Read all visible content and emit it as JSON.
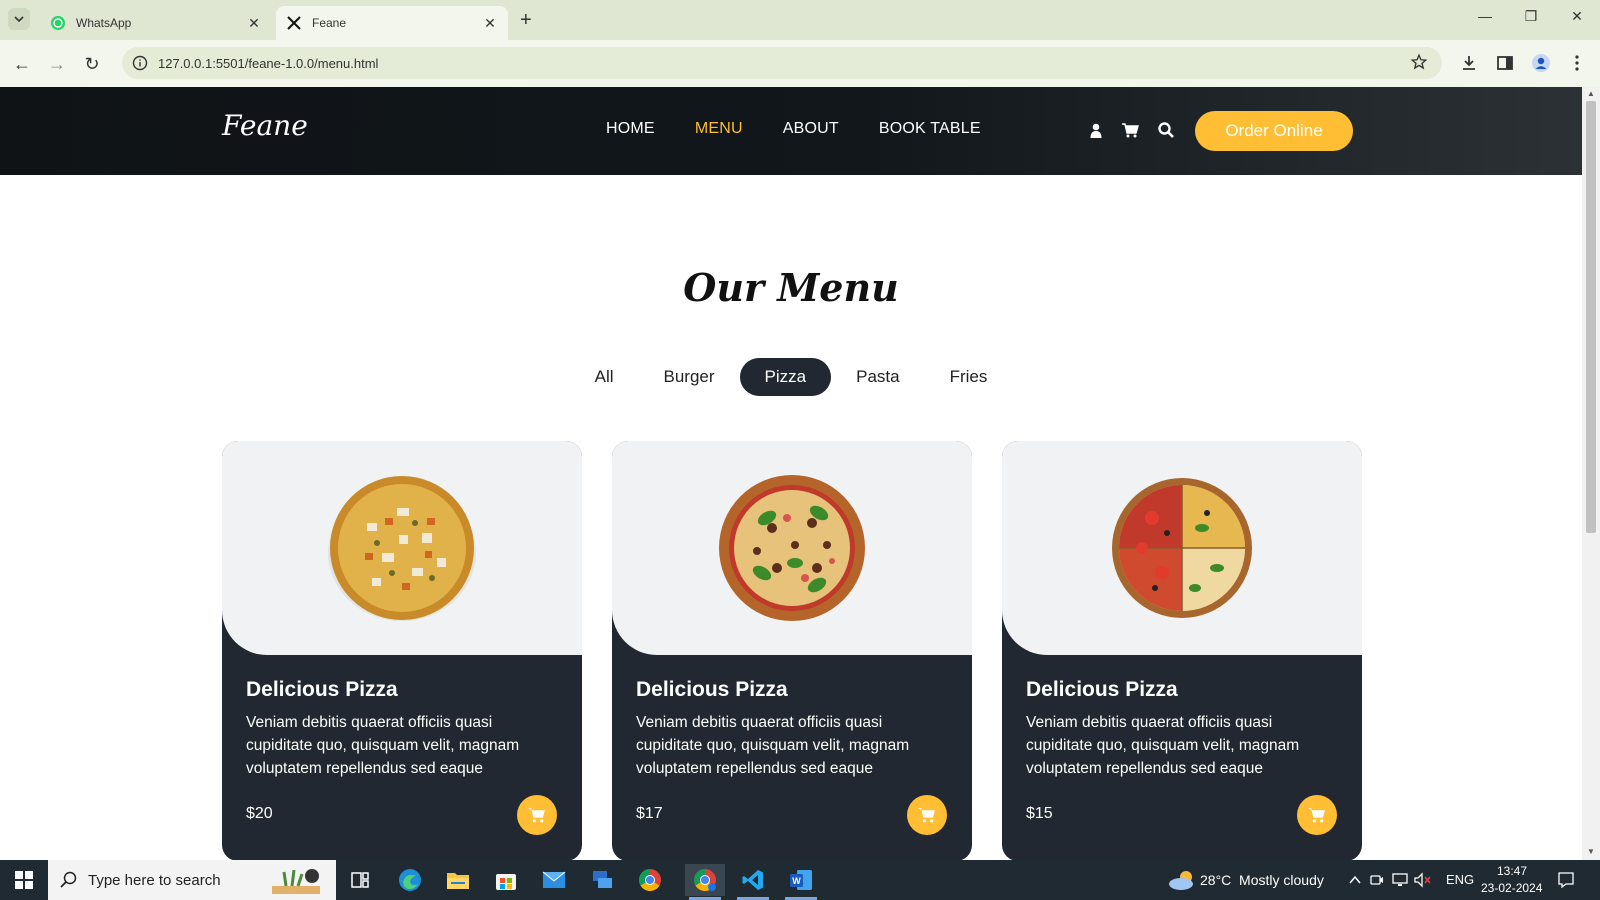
{
  "browser": {
    "tabs": [
      {
        "title": "WhatsApp",
        "icon": "whatsapp-icon"
      },
      {
        "title": "Feane",
        "icon": "feane-favicon"
      }
    ],
    "url": "127.0.0.1:5501/feane-1.0.0/menu.html"
  },
  "site": {
    "logo": "Feane",
    "nav": [
      "HOME",
      "MENU",
      "ABOUT",
      "BOOK TABLE"
    ],
    "active_nav": "MENU",
    "order_button": "Order Online",
    "accent": "#ffbe33",
    "dark": "#222831"
  },
  "menu": {
    "title": "Our Menu",
    "filters": [
      "All",
      "Burger",
      "Pizza",
      "Pasta",
      "Fries"
    ],
    "active_filter": "Pizza",
    "items": [
      {
        "title": "Delicious Pizza",
        "desc": "Veniam debitis quaerat officiis quasi cupiditate quo, quisquam velit, magnam voluptatem repellendus sed eaque",
        "price": "$20"
      },
      {
        "title": "Delicious Pizza",
        "desc": "Veniam debitis quaerat officiis quasi cupiditate quo, quisquam velit, magnam voluptatem repellendus sed eaque",
        "price": "$17"
      },
      {
        "title": "Delicious Pizza",
        "desc": "Veniam debitis quaerat officiis quasi cupiditate quo, quisquam velit, magnam voluptatem repellendus sed eaque",
        "price": "$15"
      }
    ]
  },
  "taskbar": {
    "search_placeholder": "Type here to search",
    "weather": "28°C  Mostly cloudy",
    "lang": "ENG",
    "time": "13:47",
    "date": "23-02-2024"
  }
}
